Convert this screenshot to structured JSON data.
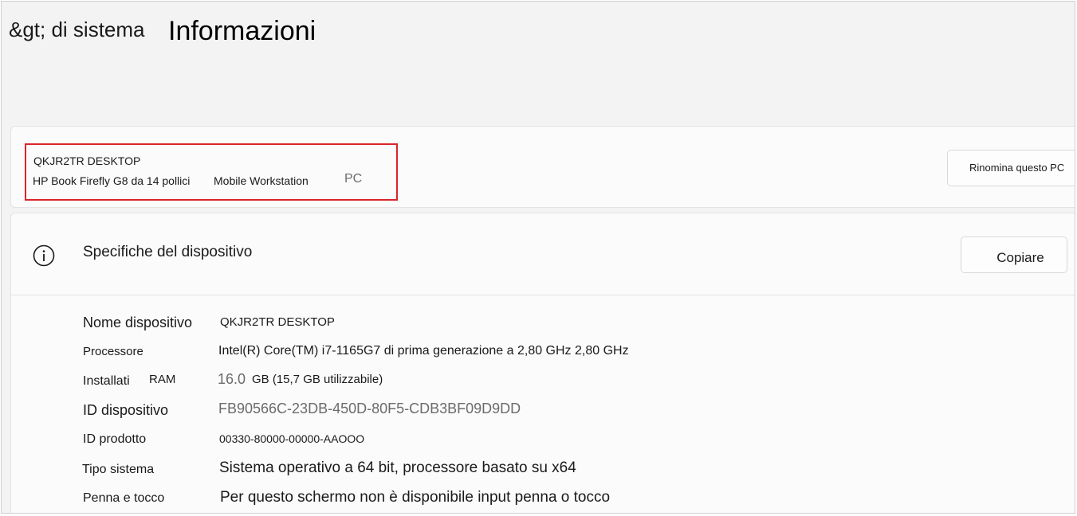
{
  "header": {
    "breadcrumb_parent": "&gt; di sistema",
    "title": "Informazioni"
  },
  "pc": {
    "name": "QKJR2TR DESKTOP",
    "model": "HP Book Firefly G8 da 14 pollici",
    "type": "Mobile Workstation",
    "kind": "PC",
    "rename_label": "Rinomina questo PC"
  },
  "specs": {
    "icon": "info-icon",
    "title": "Specifiche del dispositivo",
    "copy_label": "Copiare",
    "rows": [
      {
        "label": "Nome dispositivo",
        "value": "QKJR2TR DESKTOP"
      },
      {
        "label": "Processore",
        "value": "Intel(R) Core(TM) i7-1165G7 di prima generazione a 2,80 GHz 2,80 GHz"
      },
      {
        "label": "Installati",
        "label_extra": "RAM",
        "value_num": "16.0",
        "value": "GB (15,7 GB utilizzabile)"
      },
      {
        "label": "ID dispositivo",
        "value": "FB90566C-23DB-450D-80F5-CDB3BF09D9DD"
      },
      {
        "label": "ID prodotto",
        "value": "00330-80000-00000-AAOOO"
      },
      {
        "label": "Tipo sistema",
        "value": "Sistema operativo a 64 bit, processore basato su x64"
      },
      {
        "label": "Penna e tocco",
        "value": "Per questo schermo non è disponibile input penna o tocco"
      }
    ]
  },
  "colors": {
    "highlight": "#d9262c",
    "background": "#f3f3f3",
    "card": "#fbfbfb"
  }
}
